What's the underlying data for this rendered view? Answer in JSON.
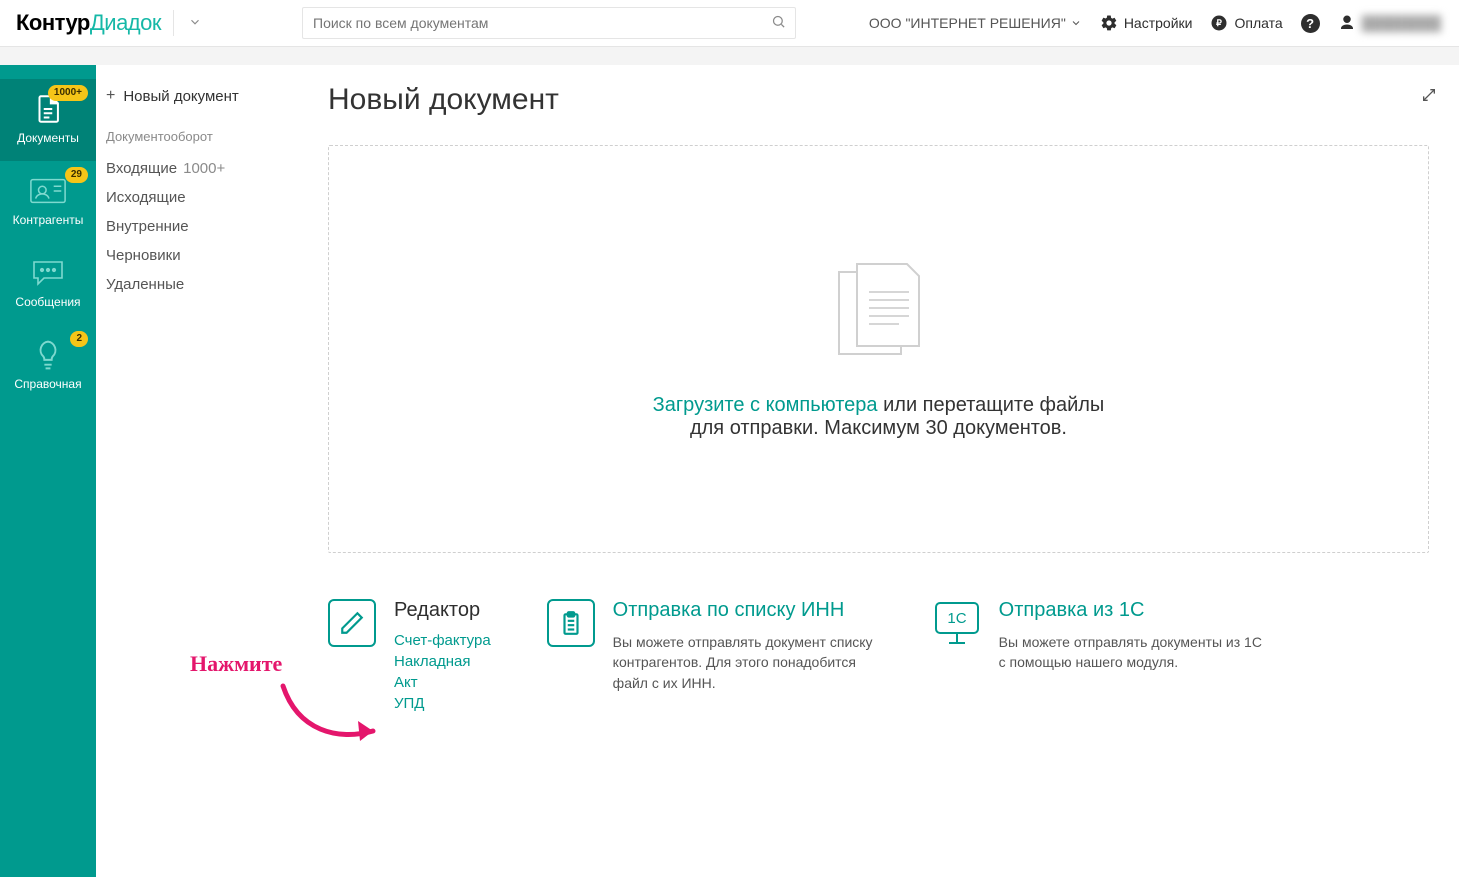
{
  "logo": {
    "part1": "Контур",
    "part2": "Диадок"
  },
  "search": {
    "placeholder": "Поиск по всем документам"
  },
  "header": {
    "org": "ООО \"ИНТЕРНЕТ РЕШЕНИЯ\"",
    "settings": "Настройки",
    "billing": "Оплата",
    "user": "████████"
  },
  "sidebar": {
    "items": [
      {
        "label": "Документы",
        "badge": "1000+"
      },
      {
        "label": "Контрагенты",
        "badge": "29"
      },
      {
        "label": "Сообщения",
        "badge": ""
      },
      {
        "label": "Справочная",
        "badge": "2"
      }
    ]
  },
  "submenu": {
    "new_doc": "Новый документ",
    "section_title": "Документооборот",
    "items": [
      {
        "label": "Входящие",
        "count": "1000+"
      },
      {
        "label": "Исходящие",
        "count": ""
      },
      {
        "label": "Внутренние",
        "count": ""
      },
      {
        "label": "Черновики",
        "count": ""
      },
      {
        "label": "Удаленные",
        "count": ""
      }
    ]
  },
  "main": {
    "title": "Новый документ",
    "dropzone": {
      "link_text": "Загрузите с компьютера",
      "rest1": " или перетащите файлы",
      "rest2": "для отправки. Максимум 30 документов."
    },
    "cards": {
      "editor": {
        "title": "Редактор",
        "links": [
          "Счет-фактура",
          "Накладная",
          "Акт",
          "УПД"
        ]
      },
      "inn": {
        "title": "Отправка по списку ИНН",
        "text": "Вы можете отправлять документ списку контрагентов. Для этого понадобится файл с их ИНН."
      },
      "onec": {
        "title": "Отправка из 1С",
        "icon_label": "1С",
        "text": "Вы можете отправлять документы из 1С с помощью нашего модуля."
      }
    }
  },
  "annotation": {
    "label": "Нажмите"
  }
}
